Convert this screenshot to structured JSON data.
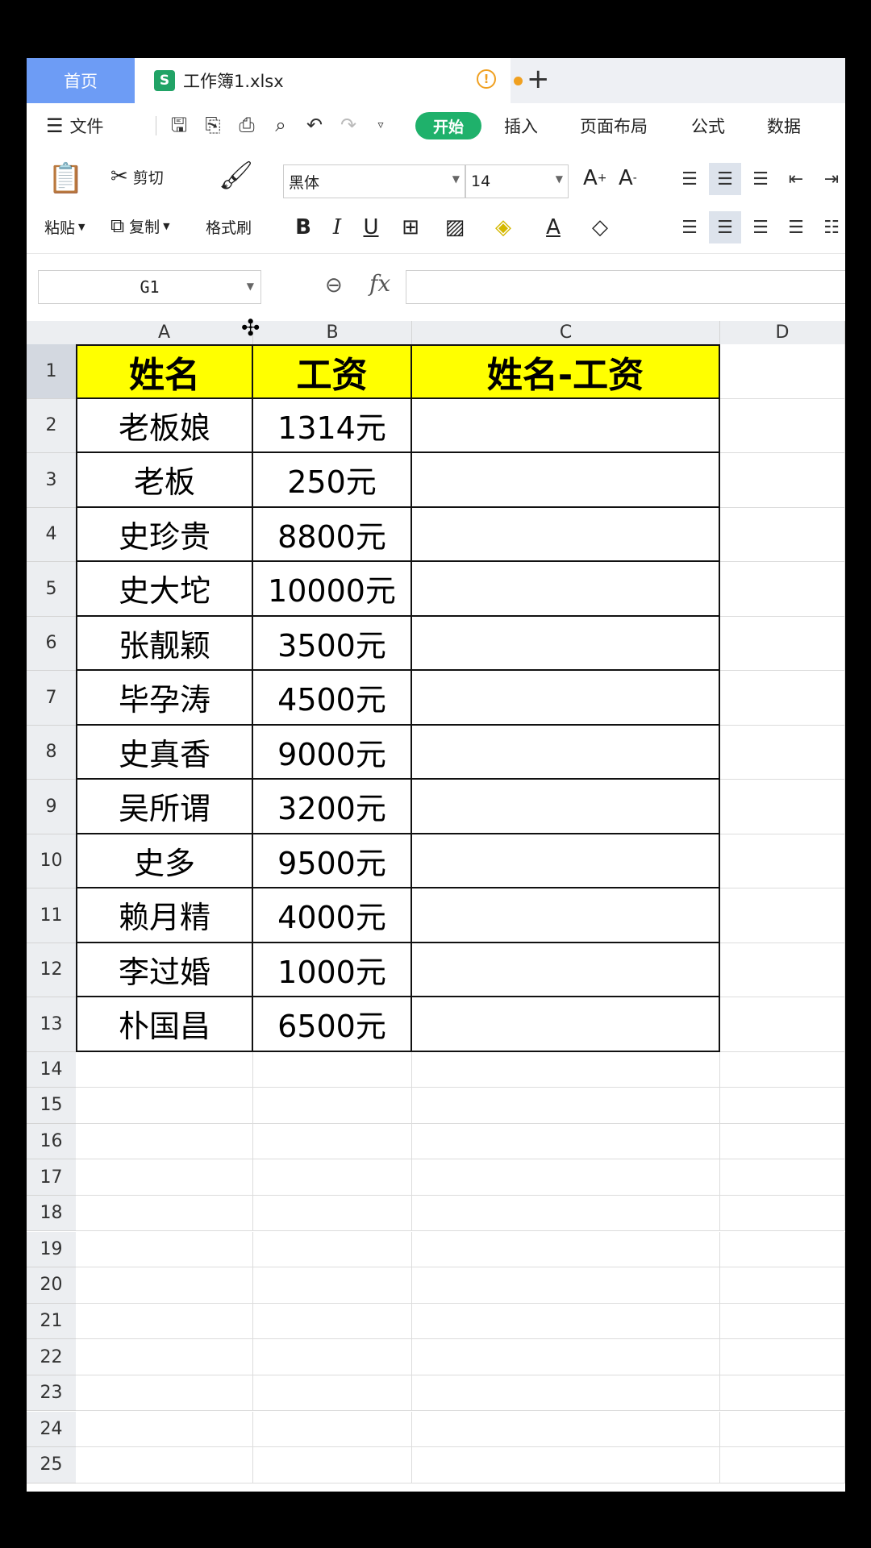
{
  "tabs": {
    "home": "首页",
    "doc_icon": "S",
    "doc_name": "工作簿1.xlsx",
    "add": "+"
  },
  "menu": {
    "file": "文件",
    "start": "开始",
    "insert": "插入",
    "page_layout": "页面布局",
    "formula": "公式",
    "data": "数据"
  },
  "ribbon": {
    "paste": "粘贴",
    "cut": "剪切",
    "copy": "复制",
    "format_painter": "格式刷",
    "font_name": "黑体",
    "font_size": "14"
  },
  "formula_bar": {
    "cell_ref": "G1",
    "fx": "fx",
    "content": ""
  },
  "columns": [
    "A",
    "B",
    "C",
    "D"
  ],
  "sheet": {
    "headers": [
      "姓名",
      "工资",
      "姓名-工资"
    ],
    "header_color": "#ffff00",
    "rows": [
      [
        "老板娘",
        "1314元",
        ""
      ],
      [
        "老板",
        "250元",
        ""
      ],
      [
        "史珍贵",
        "8800元",
        ""
      ],
      [
        "史大坨",
        "10000元",
        ""
      ],
      [
        "张靓颖",
        "3500元",
        ""
      ],
      [
        "毕孕涛",
        "4500元",
        ""
      ],
      [
        "史真香",
        "9000元",
        ""
      ],
      [
        "吴所谓",
        "3200元",
        ""
      ],
      [
        "史多",
        "9500元",
        ""
      ],
      [
        "赖月精",
        "4000元",
        ""
      ],
      [
        "李过婚",
        "1000元",
        ""
      ],
      [
        "朴国昌",
        "6500元",
        ""
      ]
    ],
    "row_numbers": [
      "1",
      "2",
      "3",
      "4",
      "5",
      "6",
      "7",
      "8",
      "9",
      "10",
      "11",
      "12",
      "13",
      "14",
      "15",
      "16",
      "17",
      "18",
      "19",
      "20",
      "21",
      "22",
      "23",
      "24",
      "25"
    ]
  },
  "colors": {
    "accent": "#1fb16b",
    "home_tab": "#6d9cf5",
    "warning": "#f0a020"
  }
}
